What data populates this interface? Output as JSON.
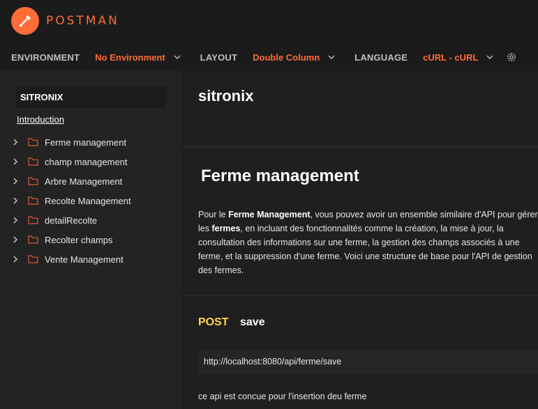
{
  "brand": {
    "name": "POSTMAN"
  },
  "topbar": {
    "environment_label": "ENVIRONMENT",
    "environment_value": "No Environment",
    "layout_label": "LAYOUT",
    "layout_value": "Double Column",
    "language_label": "LANGUAGE",
    "language_value": "cURL - cURL"
  },
  "sidebar": {
    "collection": "SITRONIX",
    "intro": "Introduction",
    "folders": [
      {
        "label": "Ferme management"
      },
      {
        "label": "champ management"
      },
      {
        "label": "Arbre Management"
      },
      {
        "label": "Recolte Management"
      },
      {
        "label": "detailRecolte"
      },
      {
        "label": "Recolter champs"
      },
      {
        "label": "Vente Management"
      }
    ]
  },
  "main": {
    "title": "sitronix",
    "section_title": "Ferme management",
    "description": {
      "p1": "Pour le ",
      "b1": "Ferme Management",
      "p2": ", vous pouvez avoir un ensemble similaire d'API pour gérer les ",
      "b2": "fermes",
      "p3": ", en incluant des fonctionnalités comme la création, la mise à jour, la consultation des informations sur une ferme, la gestion des champs associés à une ferme, et la suppression d'une ferme. Voici une structure de base pour l'API de gestion des fermes."
    },
    "request": {
      "method": "POST",
      "name": "save",
      "url": "http://localhost:8080/api/ferme/save",
      "note": "ce api est concue pour l'insertion deu ferme"
    }
  },
  "colors": {
    "accent": "#ff6c37",
    "method_post": "#ffd24d",
    "folder_icon": "#e0573a"
  }
}
